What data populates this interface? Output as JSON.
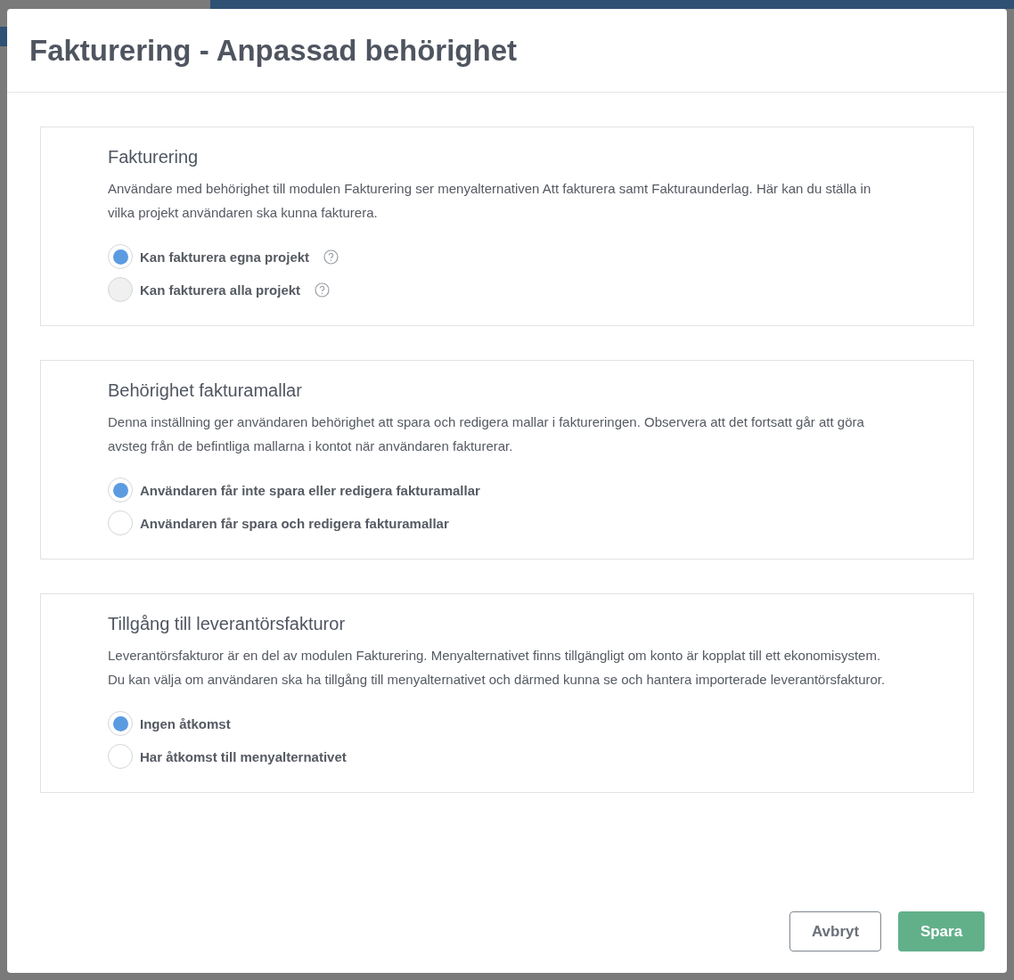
{
  "dialog": {
    "title": "Fakturering - Anpassad behörighet"
  },
  "sections": [
    {
      "title": "Fakturering",
      "description": "Användare med behörighet till modulen Fakturering ser menyalternativen Att fakturera samt Fakturaunderlag. Här kan du ställa in vilka projekt användaren ska kunna fakturera.",
      "options": [
        {
          "label": "Kan fakturera egna projekt",
          "selected": true,
          "disabled": false,
          "help": true
        },
        {
          "label": "Kan fakturera alla projekt",
          "selected": false,
          "disabled": true,
          "help": true
        }
      ]
    },
    {
      "title": "Behörighet fakturamallar",
      "description": "Denna inställning ger användaren behörighet att spara och redigera mallar i faktureringen. Observera att det fortsatt går att göra avsteg från de befintliga mallarna i kontot när användaren fakturerar.",
      "options": [
        {
          "label": "Användaren får inte spara eller redigera fakturamallar",
          "selected": true,
          "disabled": false,
          "help": false
        },
        {
          "label": "Användaren får spara och redigera fakturamallar",
          "selected": false,
          "disabled": false,
          "help": false
        }
      ]
    },
    {
      "title": "Tillgång till leverantörsfakturor",
      "description": "Leverantörsfakturor är en del av modulen Fakturering. Menyalternativet finns tillgängligt om konto är kopplat till ett ekonomisystem. Du kan välja om användaren ska ha tillgång till menyalternativet och därmed kunna se och hantera importerade leverantörsfakturor.",
      "options": [
        {
          "label": "Ingen åtkomst",
          "selected": true,
          "disabled": false,
          "help": false
        },
        {
          "label": "Har åtkomst till menyalternativet",
          "selected": false,
          "disabled": false,
          "help": false
        }
      ]
    }
  ],
  "buttons": [
    {
      "label": "Avbryt",
      "kind": "secondary"
    },
    {
      "label": "Spara",
      "kind": "primary"
    }
  ]
}
